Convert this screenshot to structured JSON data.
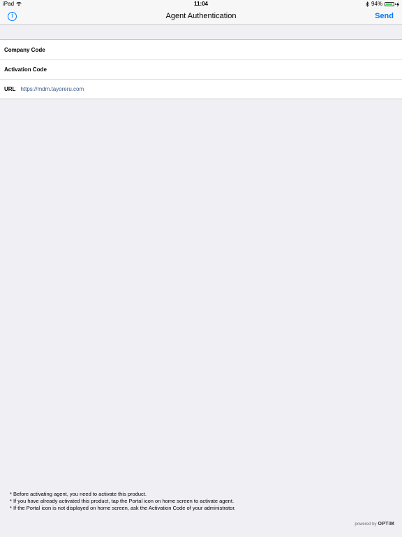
{
  "status_bar": {
    "device": "iPad",
    "time": "11:04",
    "battery_percent_label": "94%",
    "battery_level": 0.94
  },
  "nav_bar": {
    "title": "Agent Authentication",
    "send_label": "Send",
    "info_glyph": "i",
    "accent_color": "#007aff"
  },
  "form": {
    "company_code_label": "Company Code",
    "company_code_value": "",
    "activation_code_label": "Activation Code",
    "activation_code_value": "",
    "url_label": "URL",
    "url_value": "https://mdm.tayoreru.com"
  },
  "notes": [
    "* Before activating agent, you need to activate this product.",
    "* If you have already activated this product, tap the Portal icon on home screen to activate agent.",
    "* If the Portal icon is not displayed on home screen, ask the Activation Code of your administrator."
  ],
  "footer": {
    "powered_by": "powered by",
    "brand": "OPTiM"
  },
  "icons": {
    "wifi": "wifi-icon",
    "bluetooth": "bluetooth-icon",
    "battery": "battery-icon",
    "charging": "charging-icon",
    "info": "info-icon"
  }
}
